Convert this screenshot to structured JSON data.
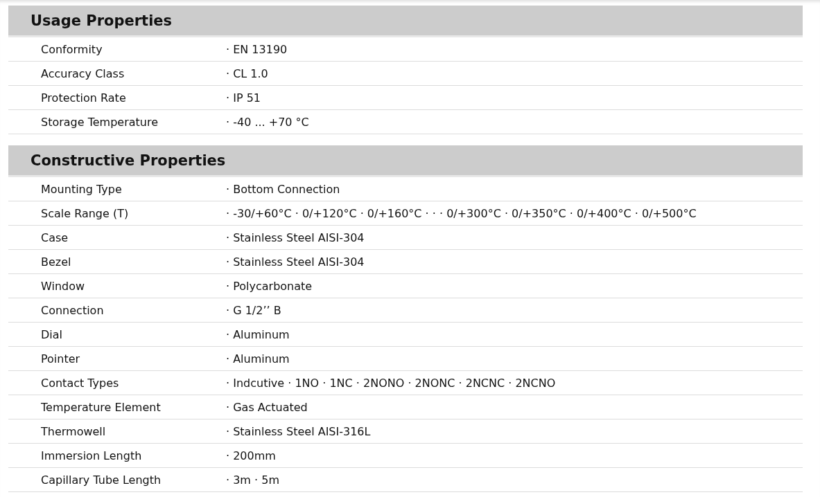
{
  "sections": [
    {
      "title": "Usage Properties",
      "rows": [
        {
          "label": "Conformity",
          "value": "· EN 13190"
        },
        {
          "label": "Accuracy Class",
          "value": "· CL 1.0"
        },
        {
          "label": "Protection Rate",
          "value": "· IP 51"
        },
        {
          "label": "Storage Temperature",
          "value": "· -40 ... +70 °C"
        }
      ]
    },
    {
      "title": "Constructive Properties",
      "rows": [
        {
          "label": "Mounting Type",
          "value": "· Bottom Connection"
        },
        {
          "label": "Scale Range (T)",
          "value": "· -30/+60°C · 0/+120°C · 0/+160°C · · · 0/+300°C · 0/+350°C · 0/+400°C · 0/+500°C"
        },
        {
          "label": "Case",
          "value": "· Stainless Steel AISI-304"
        },
        {
          "label": "Bezel",
          "value": "· Stainless Steel AISI-304"
        },
        {
          "label": "Window",
          "value": "· Polycarbonate"
        },
        {
          "label": "Connection",
          "value": "· G 1/2’’ B"
        },
        {
          "label": "Dial",
          "value": "· Aluminum"
        },
        {
          "label": "Pointer",
          "value": "· Aluminum"
        },
        {
          "label": "Contact Types",
          "value": "· Indcutive · 1NO · 1NC · 2NONO · 2NONC · 2NCNC · 2NCNO"
        },
        {
          "label": "Temperature Element",
          "value": "· Gas Actuated"
        },
        {
          "label": "Thermowell",
          "value": "· Stainless Steel AISI-316L"
        },
        {
          "label": "Immersion Length",
          "value": "· 200mm"
        },
        {
          "label": "Capillary Tube Length",
          "value": "· 3m · 5m"
        }
      ]
    }
  ]
}
